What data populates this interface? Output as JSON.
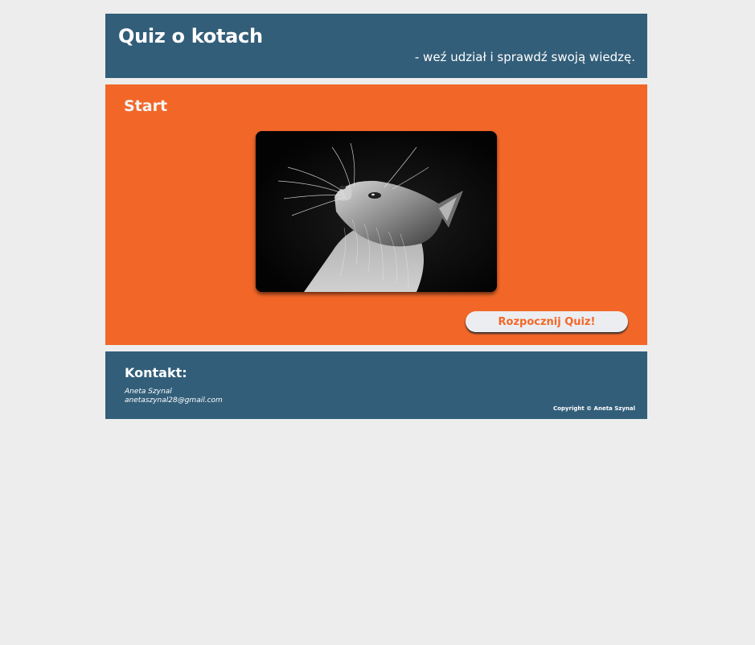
{
  "header": {
    "title": "Quiz o kotach",
    "subtitle": "- weź udział i sprawdź swoją wiedzę."
  },
  "main": {
    "section_title": "Start",
    "image": "cat-photo",
    "start_button_label": "Rozpocznij Quiz!"
  },
  "footer": {
    "contact_title": "Kontakt:",
    "contact_name": "Aneta Szynal",
    "contact_email": "anetaszynal28@gmail.com",
    "copyright": "Copyright © Aneta Szynal"
  },
  "colors": {
    "page_background": "#ededed",
    "header_background": "#325e79",
    "main_background": "#f26728",
    "button_background": "#ecedf0",
    "button_text": "#f26728"
  }
}
